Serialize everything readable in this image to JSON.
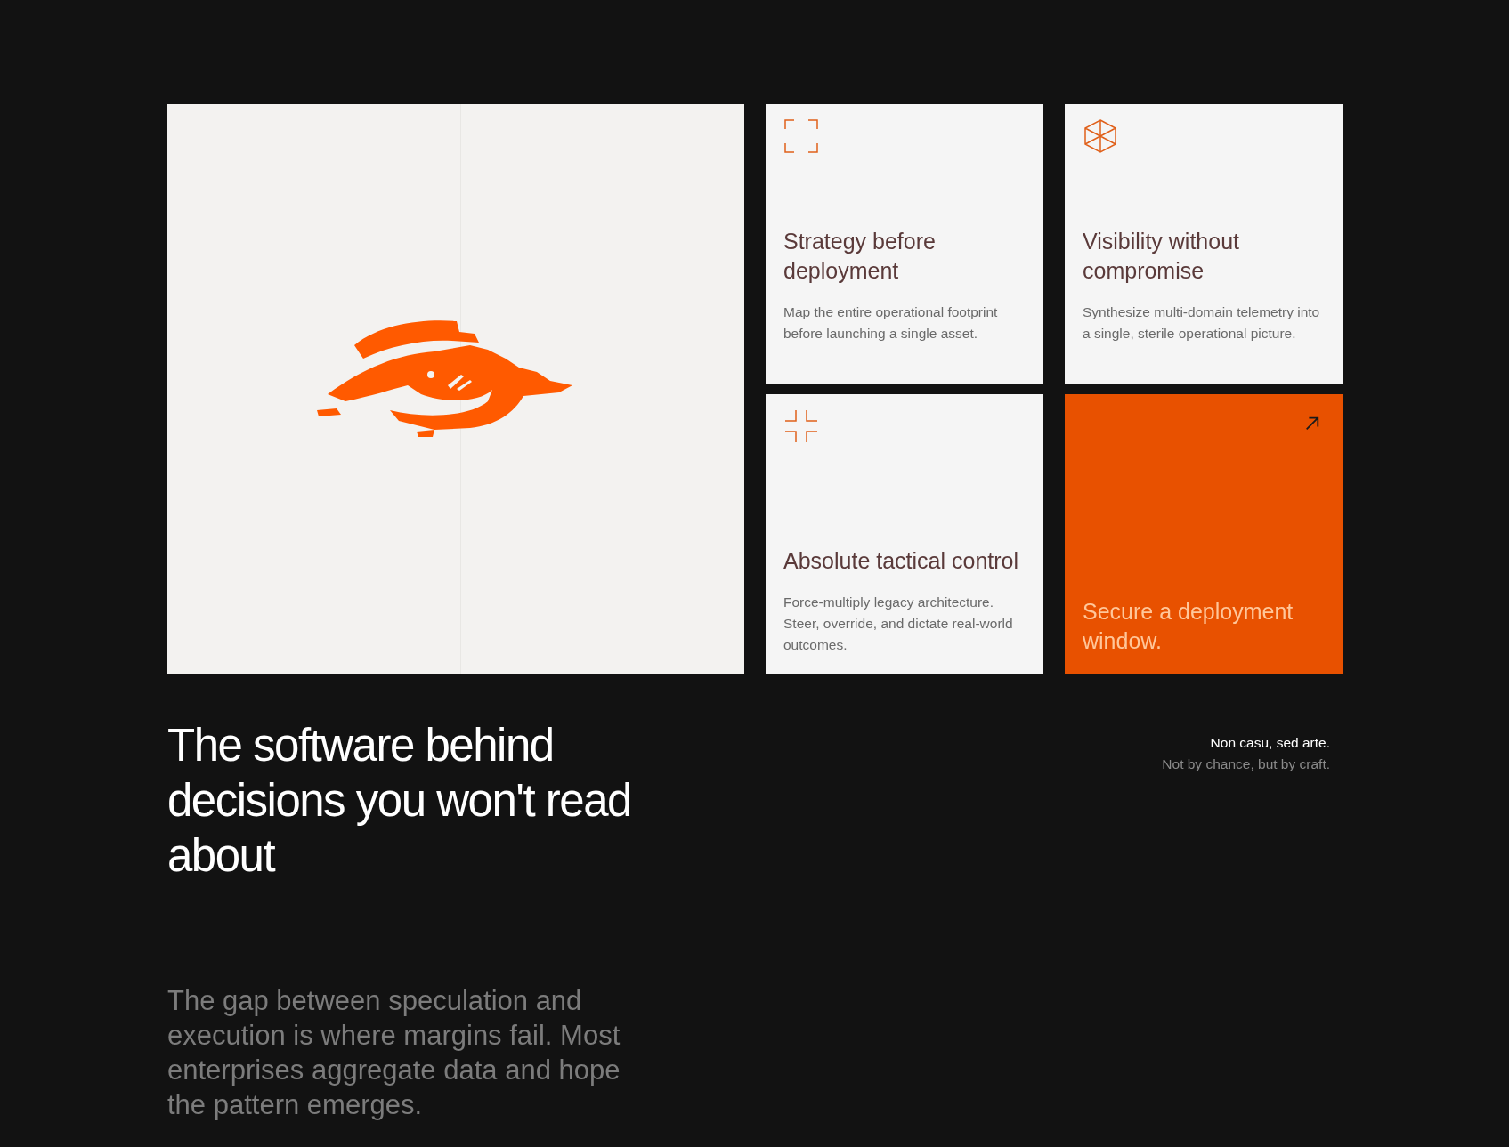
{
  "cards": [
    {
      "kind": "feature",
      "title": "Strategy before deployment",
      "text": "Map the entire operational footprint before launching a single asset."
    },
    {
      "kind": "feature",
      "title": "Visibility without compromise",
      "text": "Synthesize multi-domain telemetry into a single, sterile operational picture."
    },
    {
      "kind": "feature",
      "title": "Absolute tactical control",
      "text": "Force-multiply legacy architecture. Steer, override, and dictate real-world outcomes."
    },
    {
      "kind": "cta",
      "title": "Secure a deployment window."
    }
  ],
  "headline": "The software behind decisions you won't read about",
  "motto": {
    "latin": "Non casu, sed arte.",
    "translation": "Not by chance, but by craft."
  },
  "paragraph": "The gap between speculation and execution is where margins fail. Most enterprises aggregate data and hope the pattern emerges."
}
